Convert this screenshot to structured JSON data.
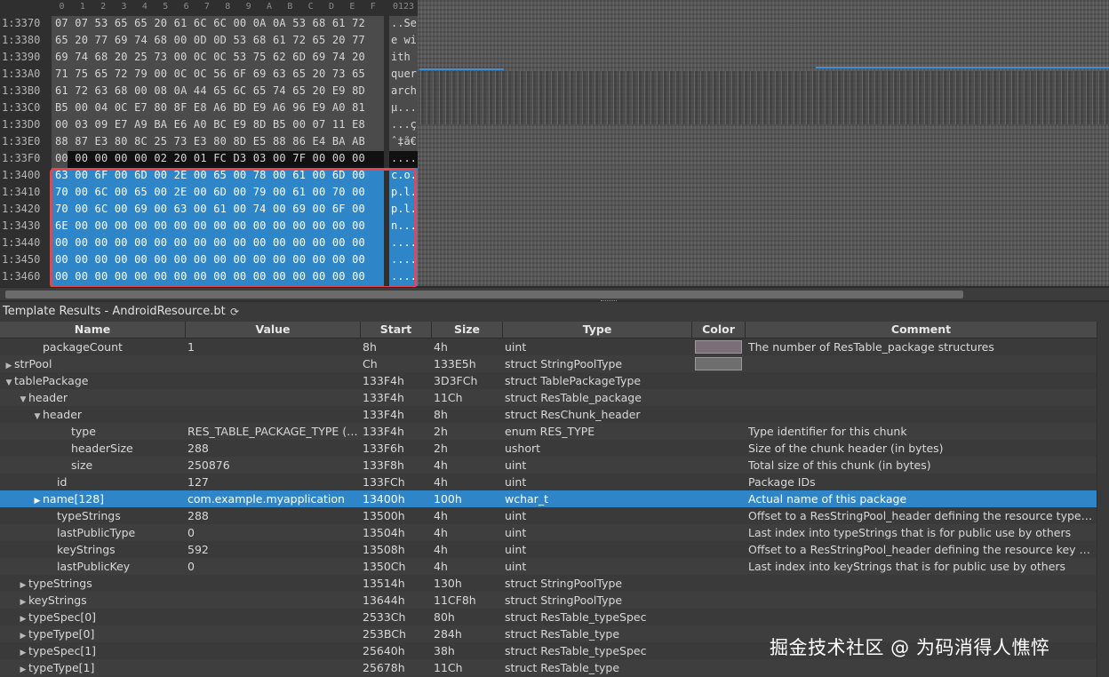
{
  "hex": {
    "column_headers": [
      "0",
      "1",
      "2",
      "3",
      "4",
      "5",
      "6",
      "7",
      "8",
      "9",
      "A",
      "B",
      "C",
      "D",
      "E",
      "F"
    ],
    "ascii_header": "0123",
    "rows": [
      {
        "addr": "1:3370",
        "bytes": "07 07 53 65 65 20 61 6C 6C 00 0A 0A 53 68 61 72",
        "ascii": "..Se",
        "state": "normal"
      },
      {
        "addr": "1:3380",
        "bytes": "65 20 77 69 74 68 00 0D 0D 53 68 61 72 65 20 77",
        "ascii": "e wi",
        "state": "normal"
      },
      {
        "addr": "1:3390",
        "bytes": "69 74 68 20 25 73 00 0C 0C 53 75 62 6D 69 74 20",
        "ascii": "ith ",
        "state": "normal"
      },
      {
        "addr": "1:33A0",
        "bytes": "71 75 65 72 79 00 0C 0C 56 6F 69 63 65 20 73 65",
        "ascii": "quer",
        "state": "normal"
      },
      {
        "addr": "1:33B0",
        "bytes": "61 72 63 68 00 08 0A 44 65 6C 65 74 65 20 E9 8D",
        "ascii": "arch",
        "state": "normal"
      },
      {
        "addr": "1:33C0",
        "bytes": "B5 00 04 0C E7 80 8F E8 A6 BD E9 A6 96 E9 A0 81",
        "ascii": "µ...",
        "state": "normal"
      },
      {
        "addr": "1:33D0",
        "bytes": "00 03 09 E7 A9 BA E6 A0 BC E9 8D B5 00 07 11 E8",
        "ascii": "...ç",
        "state": "normal"
      },
      {
        "addr": "1:33E0",
        "bytes": "88 87 E3 80 8C 25 73 E3 80 8D E5 88 86 E4 BA AB",
        "ascii": "ˆ‡ã€",
        "state": "normal"
      },
      {
        "addr": "1:33F0",
        "bytes": "00 00 00 00 00 02 20 01 FC D3 03 00 7F 00 00 00",
        "ascii": "....",
        "state": "partial"
      },
      {
        "addr": "1:3400",
        "bytes": "63 00 6F 00 6D 00 2E 00 65 00 78 00 61 00 6D 00",
        "ascii": "c.o.",
        "state": "sel"
      },
      {
        "addr": "1:3410",
        "bytes": "70 00 6C 00 65 00 2E 00 6D 00 79 00 61 00 70 00",
        "ascii": "p.l.",
        "state": "sel"
      },
      {
        "addr": "1:3420",
        "bytes": "70 00 6C 00 69 00 63 00 61 00 74 00 69 00 6F 00",
        "ascii": "p.l.",
        "state": "sel"
      },
      {
        "addr": "1:3430",
        "bytes": "6E 00 00 00 00 00 00 00 00 00 00 00 00 00 00 00",
        "ascii": "n...",
        "state": "sel"
      },
      {
        "addr": "1:3440",
        "bytes": "00 00 00 00 00 00 00 00 00 00 00 00 00 00 00 00",
        "ascii": "....",
        "state": "sel"
      },
      {
        "addr": "1:3450",
        "bytes": "00 00 00 00 00 00 00 00 00 00 00 00 00 00 00 00",
        "ascii": "....",
        "state": "sel"
      },
      {
        "addr": "1:3460",
        "bytes": "00 00 00 00 00 00 00 00 00 00 00 00 00 00 00 00",
        "ascii": "....",
        "state": "sel"
      }
    ]
  },
  "template": {
    "title": "Template Results - AndroidResource.bt",
    "refresh_icon": "refresh-icon",
    "columns": {
      "name": "Name",
      "value": "Value",
      "start": "Start",
      "size": "Size",
      "type": "Type",
      "color": "Color",
      "comment": "Comment"
    },
    "rows": [
      {
        "indent": 2,
        "toggle": "",
        "name": "packageCount",
        "value": "1",
        "start": "8h",
        "size": "4h",
        "type": "uint",
        "color": "#7a6e78",
        "comment": "The number of ResTable_package structures"
      },
      {
        "indent": 0,
        "toggle": "collapsed",
        "name": "strPool",
        "value": "",
        "start": "Ch",
        "size": "133E5h",
        "type": "struct StringPoolType",
        "color": "#6e6e6e",
        "comment": ""
      },
      {
        "indent": 0,
        "toggle": "expanded",
        "name": "tablePackage",
        "value": "",
        "start": "133F4h",
        "size": "3D3FCh",
        "type": "struct TablePackageType",
        "color": "",
        "comment": ""
      },
      {
        "indent": 1,
        "toggle": "expanded",
        "name": "header",
        "value": "",
        "start": "133F4h",
        "size": "11Ch",
        "type": "struct ResTable_package",
        "color": "",
        "comment": ""
      },
      {
        "indent": 2,
        "toggle": "expanded",
        "name": "header",
        "value": "",
        "start": "133F4h",
        "size": "8h",
        "type": "struct ResChunk_header",
        "color": "",
        "comment": ""
      },
      {
        "indent": 4,
        "toggle": "",
        "name": "type",
        "value": "RES_TABLE_PACKAGE_TYPE (5...",
        "start": "133F4h",
        "size": "2h",
        "type": "enum RES_TYPE",
        "color": "",
        "comment": "Type identifier for this chunk"
      },
      {
        "indent": 4,
        "toggle": "",
        "name": "headerSize",
        "value": "288",
        "start": "133F6h",
        "size": "2h",
        "type": "ushort",
        "color": "",
        "comment": "Size of the chunk header (in bytes)"
      },
      {
        "indent": 4,
        "toggle": "",
        "name": "size",
        "value": "250876",
        "start": "133F8h",
        "size": "4h",
        "type": "uint",
        "color": "",
        "comment": "Total size of this chunk (in bytes)"
      },
      {
        "indent": 3,
        "toggle": "",
        "name": "id",
        "value": "127",
        "start": "133FCh",
        "size": "4h",
        "type": "uint",
        "color": "",
        "comment": "Package IDs"
      },
      {
        "indent": 2,
        "toggle": "collapsed",
        "name": "name[128]",
        "value": "com.example.myapplication",
        "start": "13400h",
        "size": "100h",
        "type": "wchar_t",
        "color": "",
        "comment": "Actual name of this package",
        "selected": true
      },
      {
        "indent": 3,
        "toggle": "",
        "name": "typeStrings",
        "value": "288",
        "start": "13500h",
        "size": "4h",
        "type": "uint",
        "color": "",
        "comment": "Offset to a ResStringPool_header defining the resource type sy..."
      },
      {
        "indent": 3,
        "toggle": "",
        "name": "lastPublicType",
        "value": "0",
        "start": "13504h",
        "size": "4h",
        "type": "uint",
        "color": "",
        "comment": "Last index into typeStrings that is for public use by others"
      },
      {
        "indent": 3,
        "toggle": "",
        "name": "keyStrings",
        "value": "592",
        "start": "13508h",
        "size": "4h",
        "type": "uint",
        "color": "",
        "comment": "Offset to a ResStringPool_header defining the resource key sy..."
      },
      {
        "indent": 3,
        "toggle": "",
        "name": "lastPublicKey",
        "value": "0",
        "start": "1350Ch",
        "size": "4h",
        "type": "uint",
        "color": "",
        "comment": "Last index into keyStrings that is for public use by others"
      },
      {
        "indent": 1,
        "toggle": "collapsed",
        "name": "typeStrings",
        "value": "",
        "start": "13514h",
        "size": "130h",
        "type": "struct StringPoolType",
        "color": "",
        "comment": ""
      },
      {
        "indent": 1,
        "toggle": "collapsed",
        "name": "keyStrings",
        "value": "",
        "start": "13644h",
        "size": "11CF8h",
        "type": "struct StringPoolType",
        "color": "",
        "comment": ""
      },
      {
        "indent": 1,
        "toggle": "collapsed",
        "name": "typeSpec[0]",
        "value": "",
        "start": "2533Ch",
        "size": "80h",
        "type": "struct ResTable_typeSpec",
        "color": "",
        "comment": ""
      },
      {
        "indent": 1,
        "toggle": "collapsed",
        "name": "typeType[0]",
        "value": "",
        "start": "253BCh",
        "size": "284h",
        "type": "struct ResTable_type",
        "color": "",
        "comment": ""
      },
      {
        "indent": 1,
        "toggle": "collapsed",
        "name": "typeSpec[1]",
        "value": "",
        "start": "25640h",
        "size": "38h",
        "type": "struct ResTable_typeSpec",
        "color": "",
        "comment": ""
      },
      {
        "indent": 1,
        "toggle": "collapsed",
        "name": "typeType[1]",
        "value": "",
        "start": "25678h",
        "size": "11Ch",
        "type": "struct ResTable_type",
        "color": "",
        "comment": ""
      }
    ]
  },
  "colors": {
    "selection": "#2e86c9",
    "highlight_outline": "#e5474c",
    "background": "#3a3a3a"
  },
  "watermark": "掘金技术社区 @ 为码消得人憔悴"
}
